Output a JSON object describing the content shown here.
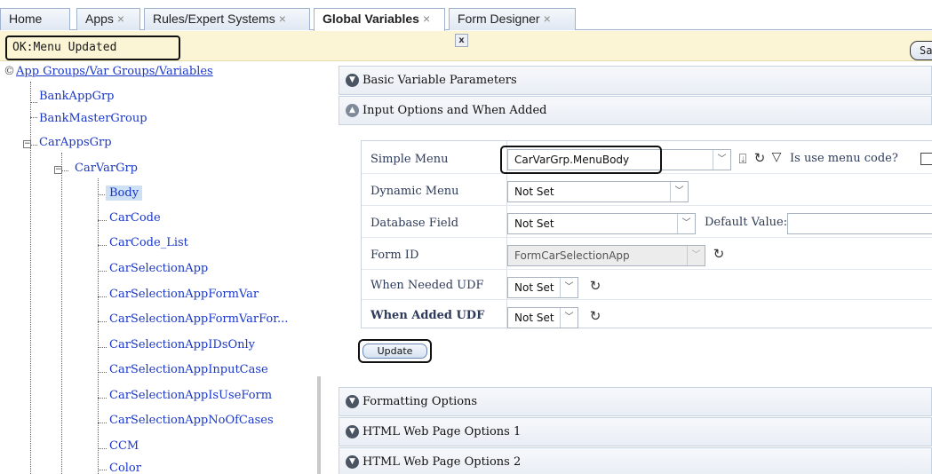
{
  "tabs": [
    {
      "label": "Home",
      "closable": false,
      "active": false
    },
    {
      "label": "Apps",
      "closable": true,
      "active": false
    },
    {
      "label": "Rules/Expert Systems",
      "closable": true,
      "active": false
    },
    {
      "label": "Global Variables",
      "closable": true,
      "active": true
    },
    {
      "label": "Form Designer",
      "closable": true,
      "active": false
    }
  ],
  "close_glyph": "×",
  "status": {
    "message": "OK:Menu Updated",
    "close_glyph": "x",
    "save_label": "Save"
  },
  "tree": {
    "root_glyph": "©",
    "root_label": "App Groups/Var Groups/Variables",
    "groups": [
      "BankAppGrp",
      "BankMasterGroup",
      "CarAppsGrp"
    ],
    "subgroup": "CarVarGrp",
    "variables": [
      "Body",
      "CarCode",
      "CarCode_List",
      "CarSelectionApp",
      "CarSelectionAppFormVar",
      "CarSelectionAppFormVarFor...",
      "CarSelectionAppIDsOnly",
      "CarSelectionAppInputCase",
      "CarSelectionAppIsUseForm",
      "CarSelectionAppNoOfCases",
      "CCM",
      "Color"
    ],
    "selected": "Body",
    "expander_minus": "−"
  },
  "sections": {
    "basic": "Basic Variable Parameters",
    "input_options": "Input Options and When Added",
    "formatting": "Formatting Options",
    "html1": "HTML Web Page Options 1",
    "html2": "HTML Web Page Options 2"
  },
  "form": {
    "simple_menu": {
      "label": "Simple Menu",
      "value": "CarVarGrp.MenuBody"
    },
    "is_use_menu_code": {
      "label": "Is use menu code?",
      "checked": false
    },
    "dynamic_menu": {
      "label": "Dynamic Menu",
      "value": "Not Set"
    },
    "database_field": {
      "label": "Database Field",
      "value": "Not Set"
    },
    "default_value": {
      "label": "Default Value:",
      "value": ""
    },
    "form_id": {
      "label": "Form ID",
      "value": "FormCarSelectionApp"
    },
    "when_needed_udf": {
      "label": "When Needed UDF",
      "value": "Not Set"
    },
    "when_added_udf": {
      "label": "When Added UDF",
      "value": "Not Set"
    },
    "update_label": "Update"
  },
  "icons": {
    "import": "⍗",
    "refresh": "↻",
    "filter": "▽",
    "dropdown": "﹀",
    "chevron_down": "▼",
    "chevron_up": "▲"
  },
  "colors": {
    "status_bg": "#fbf5d6",
    "link_blue": "#1a37c8",
    "selected_bg": "#cde0f4",
    "accordion_icon": "#4a5463"
  }
}
